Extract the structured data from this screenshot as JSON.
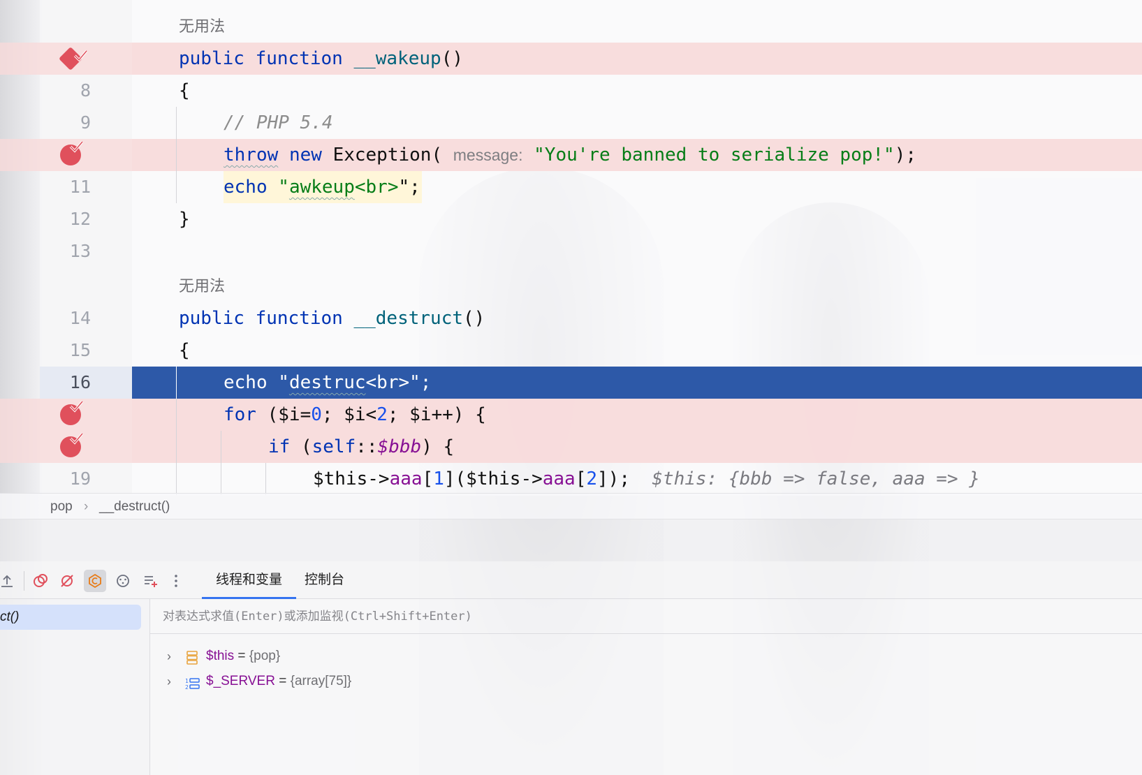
{
  "editor": {
    "usage_hint": "无用法",
    "lines": [
      {
        "num": "",
        "kind": "usage",
        "text": "无用法"
      },
      {
        "num": "",
        "kind": "code",
        "text": "public function __wakeup()"
      },
      {
        "num": "8",
        "kind": "code",
        "text": "{"
      },
      {
        "num": "9",
        "kind": "code",
        "text": "// PHP 5.4"
      },
      {
        "num": "",
        "kind": "code",
        "text": "throw new Exception( message: \"You're banned to serialize pop!\");"
      },
      {
        "num": "11",
        "kind": "code",
        "text": "echo \"awkeup<br>\";"
      },
      {
        "num": "12",
        "kind": "code",
        "text": "}"
      },
      {
        "num": "13",
        "kind": "code",
        "text": ""
      },
      {
        "num": "",
        "kind": "usage",
        "text": "无用法"
      },
      {
        "num": "14",
        "kind": "code",
        "text": "public function __destruct()"
      },
      {
        "num": "15",
        "kind": "code",
        "text": "{"
      },
      {
        "num": "16",
        "kind": "code",
        "text": "echo \"destruc<br>\";"
      },
      {
        "num": "",
        "kind": "code",
        "text": "for ($i=0; $i<2; $i++) {"
      },
      {
        "num": "",
        "kind": "code",
        "text": "if (self::$bbb) {"
      },
      {
        "num": "19",
        "kind": "code",
        "text": "$this->aaa[1]($this->aaa[2]);"
      }
    ],
    "tokens": {
      "public": "public",
      "function": "function",
      "wakeup": "__wakeup",
      "destruct": "__destruct",
      "parens": "()",
      "brace_open": "{",
      "brace_close": "}",
      "comment": "// PHP 5.4",
      "throw": "throw",
      "new": "new",
      "exception": "Exception(",
      "param_hint": "message:",
      "banned_str": "\"You're banned to serialize pop!\"",
      "close_stmt": ");",
      "echo": "echo",
      "q": "\"",
      "awkeup": "awkeup",
      "br_tag": "<br>",
      "q_semi": "\";",
      "destruc_stmt": " \"destruc<br>\";",
      "destruc_q": "\"",
      "destruc": "destruc",
      "destruc_rest": "<br>\";",
      "for": "for",
      "for_open": " ($i=",
      "zero": "0",
      "for_mid": "; $i<",
      "two": "2",
      "for_end": "; $i++) {",
      "if": "if",
      "if_open": " (",
      "self": "self",
      "dcolon": "::",
      "bbb": "$bbb",
      "if_end": ") {",
      "this1": "$this->",
      "aaa": "aaa",
      "lb": "[",
      "one": "1",
      "rb_paren": "](",
      "this2": "$this->",
      "aaa2": "aaa",
      "lb2": "[",
      "two2": "2",
      "end19": "]);",
      "inline_value": "$this: {bbb => false, aaa => }"
    },
    "line_numbers": {
      "l8": "8",
      "l9": "9",
      "l11": "11",
      "l12": "12",
      "l13": "13",
      "l14": "14",
      "l15": "15",
      "l16": "16",
      "l19": "19"
    }
  },
  "breadcrumb": {
    "class": "pop",
    "separator": "›",
    "method": "__destruct()"
  },
  "debug": {
    "tabs": [
      {
        "label": "线程和变量",
        "selected": true
      },
      {
        "label": "控制台",
        "selected": false
      }
    ],
    "toolbar_icons": [
      "step-out-icon",
      "view-breakpoints-icon",
      "mute-breakpoints-icon",
      "coverage-icon",
      "more-settings-icon",
      "add-watch-icon",
      "more-options-icon"
    ],
    "frame": {
      "label": "ct()"
    },
    "eval_placeholder": "对表达式求值(Enter)或添加监视(Ctrl+Shift+Enter)",
    "variables": [
      {
        "name": "$this",
        "eq": " = ",
        "value": "{pop}",
        "icon": "object-icon"
      },
      {
        "name": "$_SERVER",
        "eq": " = ",
        "value": "{array[75]}",
        "icon": "array-icon"
      }
    ]
  },
  "colors": {
    "breakpoint": "#e0505c",
    "current_line": "#2d59a8",
    "breakpoint_line": "#f8dada",
    "keyword": "#0033b3",
    "string": "#067d17",
    "number": "#1750eb",
    "field": "#871094",
    "tab_underline": "#3574f0"
  }
}
